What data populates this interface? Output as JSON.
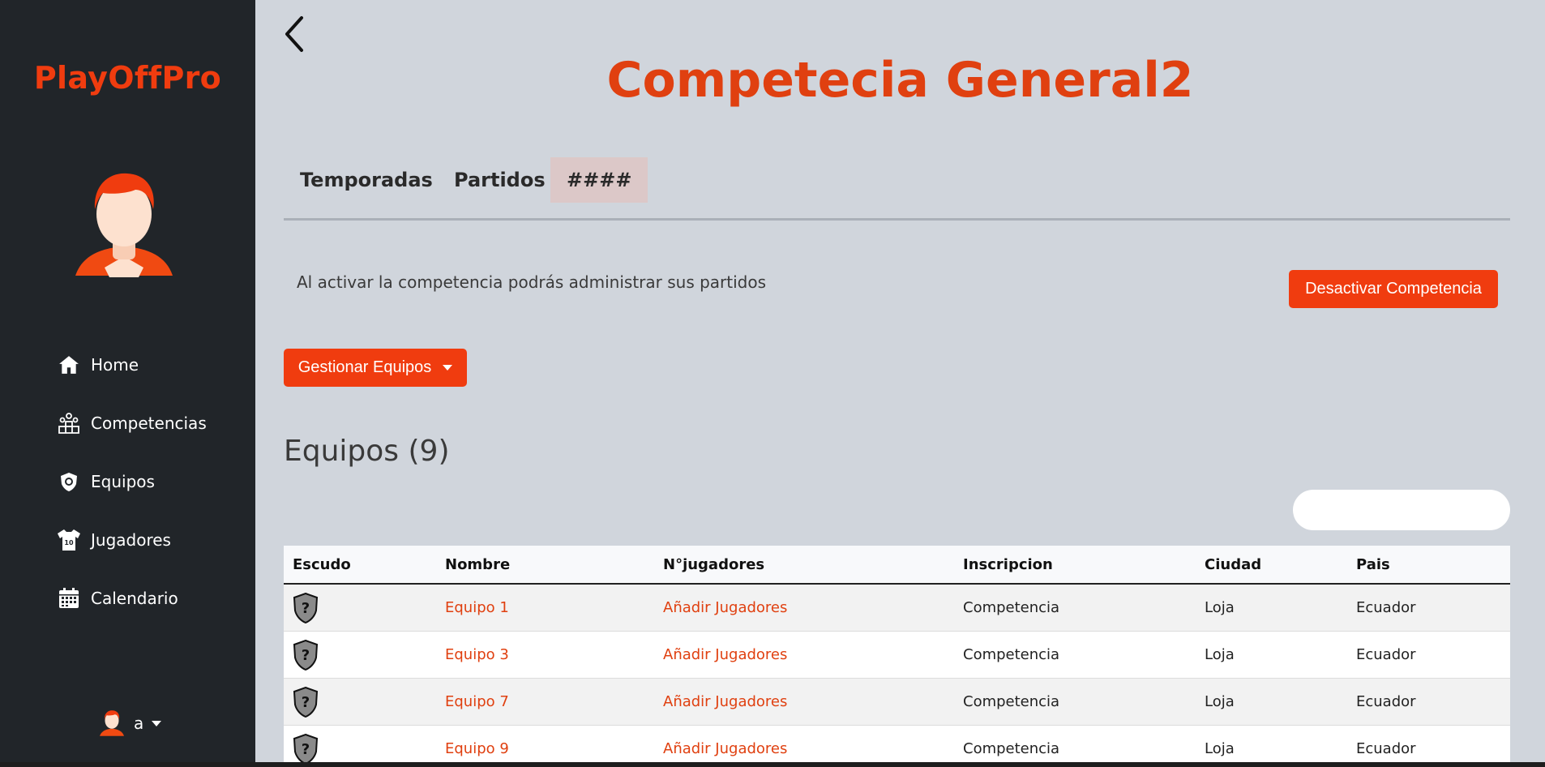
{
  "brand": {
    "name": "PlayOffPro",
    "color": "#f03c0f"
  },
  "sidebar": {
    "items": [
      {
        "label": "Home",
        "icon": "home-icon"
      },
      {
        "label": "Competencias",
        "icon": "podium-icon"
      },
      {
        "label": "Equipos",
        "icon": "team-badge-icon"
      },
      {
        "label": "Jugadores",
        "icon": "jersey-icon"
      },
      {
        "label": "Calendario",
        "icon": "calendar-icon"
      }
    ],
    "user": {
      "name": "a"
    }
  },
  "main": {
    "title": "Competecia General2",
    "tabs": [
      {
        "label": "Temporadas"
      },
      {
        "label": "Partidos"
      },
      {
        "label": "####"
      }
    ],
    "info_text": "Al activar la competencia podrás administrar sus partidos",
    "deactivate_button": "Desactivar Competencia",
    "manage_button": "Gestionar Equipos",
    "section_title": "Equipos (9)",
    "search_placeholder": ""
  },
  "table": {
    "headers": [
      "Escudo",
      "Nombre",
      "N°jugadores",
      "Inscripcion",
      "Ciudad",
      "Pais"
    ],
    "rows": [
      {
        "name": "Equipo 1",
        "players": "Añadir Jugadores",
        "registration": "Competencia",
        "city": "Loja",
        "country": "Ecuador"
      },
      {
        "name": "Equipo 3",
        "players": "Añadir Jugadores",
        "registration": "Competencia",
        "city": "Loja",
        "country": "Ecuador"
      },
      {
        "name": "Equipo 7",
        "players": "Añadir Jugadores",
        "registration": "Competencia",
        "city": "Loja",
        "country": "Ecuador"
      },
      {
        "name": "Equipo 9",
        "players": "Añadir Jugadores",
        "registration": "Competencia",
        "city": "Loja",
        "country": "Ecuador"
      }
    ]
  },
  "colors": {
    "accent": "#f03c0f",
    "sidebar_bg": "#212529",
    "page_bg": "#d0d5dc"
  }
}
